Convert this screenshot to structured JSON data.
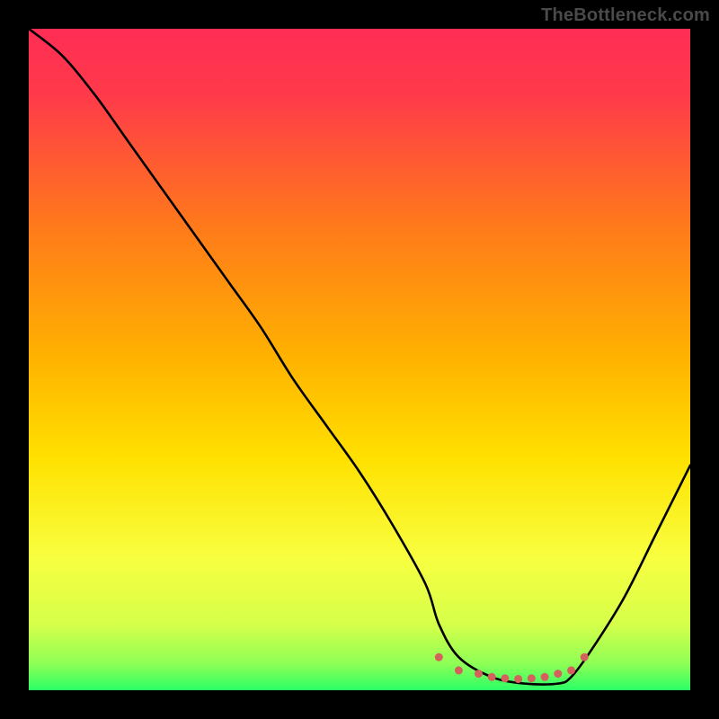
{
  "attribution": "TheBottleneck.com",
  "colors": {
    "top": "#ff2d55",
    "mid_upper": "#ff8a00",
    "mid": "#ffd400",
    "mid_lower": "#f6ff4a",
    "bottom": "#2aff66",
    "line": "#000000",
    "dots": "#d5615c",
    "frame": "#000000"
  },
  "chart_data": {
    "type": "line",
    "title": "",
    "xlabel": "",
    "ylabel": "",
    "ylim": [
      0,
      100
    ],
    "xlim": [
      0,
      100
    ],
    "series": [
      {
        "name": "bottleneck-curve",
        "x": [
          0,
          5,
          10,
          15,
          20,
          25,
          30,
          35,
          40,
          45,
          50,
          55,
          60,
          62,
          65,
          70,
          75,
          80,
          82,
          85,
          90,
          95,
          100
        ],
        "values": [
          100,
          96,
          90,
          83,
          76,
          69,
          62,
          55,
          47,
          40,
          33,
          25,
          16,
          10,
          5,
          2,
          1,
          1,
          2,
          6,
          14,
          24,
          34
        ]
      }
    ],
    "dots": {
      "name": "optimal-range-markers",
      "x": [
        62,
        65,
        68,
        70,
        72,
        74,
        76,
        78,
        80,
        82,
        84
      ],
      "values": [
        5,
        3,
        2.5,
        2,
        1.8,
        1.7,
        1.8,
        2,
        2.5,
        3,
        5
      ]
    },
    "gradient_stops": [
      {
        "offset": 0.0,
        "color": "#ff2d55"
      },
      {
        "offset": 0.1,
        "color": "#ff3a4a"
      },
      {
        "offset": 0.3,
        "color": "#ff7a1a"
      },
      {
        "offset": 0.5,
        "color": "#ffb300"
      },
      {
        "offset": 0.65,
        "color": "#ffe100"
      },
      {
        "offset": 0.8,
        "color": "#f8ff40"
      },
      {
        "offset": 0.9,
        "color": "#d6ff4a"
      },
      {
        "offset": 0.96,
        "color": "#8eff55"
      },
      {
        "offset": 1.0,
        "color": "#2aff66"
      }
    ]
  }
}
